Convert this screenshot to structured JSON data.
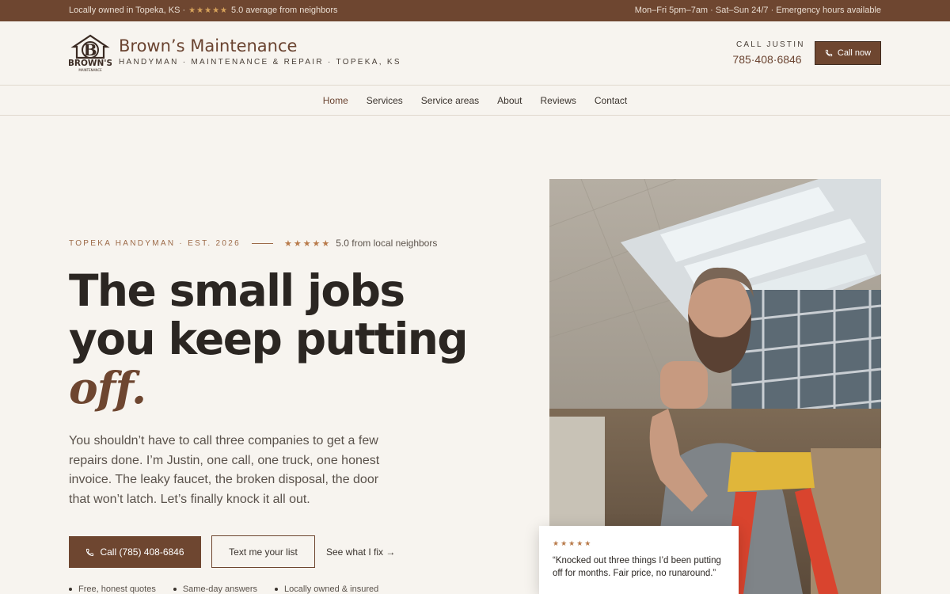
{
  "topbar": {
    "location": "Locally owned in Topeka, KS ·",
    "stars": "★★★★★",
    "rating": "5.0 average from neighbors",
    "hours": "Mon–Fri 5pm–7am · Sat–Sun 24/7 · Emergency hours available"
  },
  "brand": {
    "name": "Brown’s Maintenance",
    "tagline": "HANDYMAN · MAINTENANCE & REPAIR · TOPEKA, KS",
    "logo_text": "BROWN'S",
    "logo_sub": "MAINTENANCE",
    "logo_letter": "B"
  },
  "header_call": {
    "label": "CALL JUSTIN",
    "phone": "785·408·6846",
    "button": "Call now"
  },
  "nav": {
    "items": [
      "Home",
      "Services",
      "Service areas",
      "About",
      "Reviews",
      "Contact"
    ],
    "active": "Home"
  },
  "hero": {
    "eyebrow": "TOPEKA HANDYMAN · EST. 2026",
    "stars": "★★★★★",
    "rating": "5.0 from local neighbors",
    "headline_1": "The small jobs",
    "headline_2": "you keep putting",
    "headline_accent": "off.",
    "lede": "You shouldn’t have to call three companies to get a few repairs done. I’m Justin, one call, one truck, one honest invoice. The leaky faucet, the broken disposal, the door that won’t latch. Let’s finally knock it all out.",
    "primary_cta": "Call (785) 408-6846",
    "secondary_cta": "Text me your list",
    "link_cta": "See what I fix  →",
    "bullets": [
      "Free, honest quotes",
      "Same-day answers",
      "Locally owned & insured"
    ]
  },
  "review": {
    "stars": "★★★★★",
    "quote": "“Knocked out three things I’d been putting off for months. Fair price, no runaround.”"
  },
  "colors": {
    "brand_brown": "#6e4630",
    "background": "#f7f4ef",
    "star": "#b87a4a"
  }
}
